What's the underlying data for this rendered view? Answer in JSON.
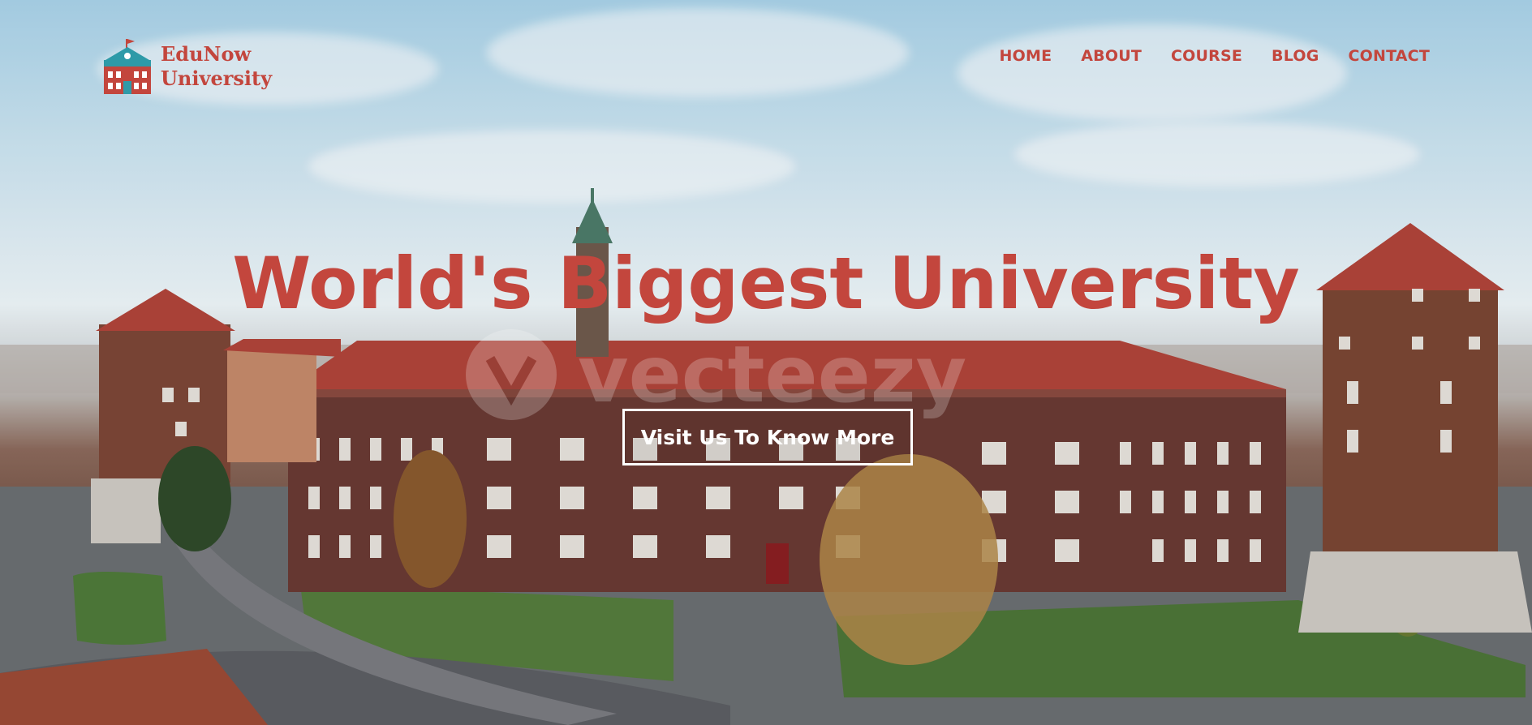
{
  "brand": {
    "name_line1": "EduNow",
    "name_line2": "University",
    "accent_color": "#c3463d"
  },
  "nav": {
    "items": [
      {
        "label": "HOME"
      },
      {
        "label": "ABOUT"
      },
      {
        "label": "COURSE"
      },
      {
        "label": "BLOG"
      },
      {
        "label": "CONTACT"
      }
    ]
  },
  "hero": {
    "title": "World's Biggest University",
    "cta_label": "Visit Us To Know More",
    "watermark": "vecteezy"
  }
}
